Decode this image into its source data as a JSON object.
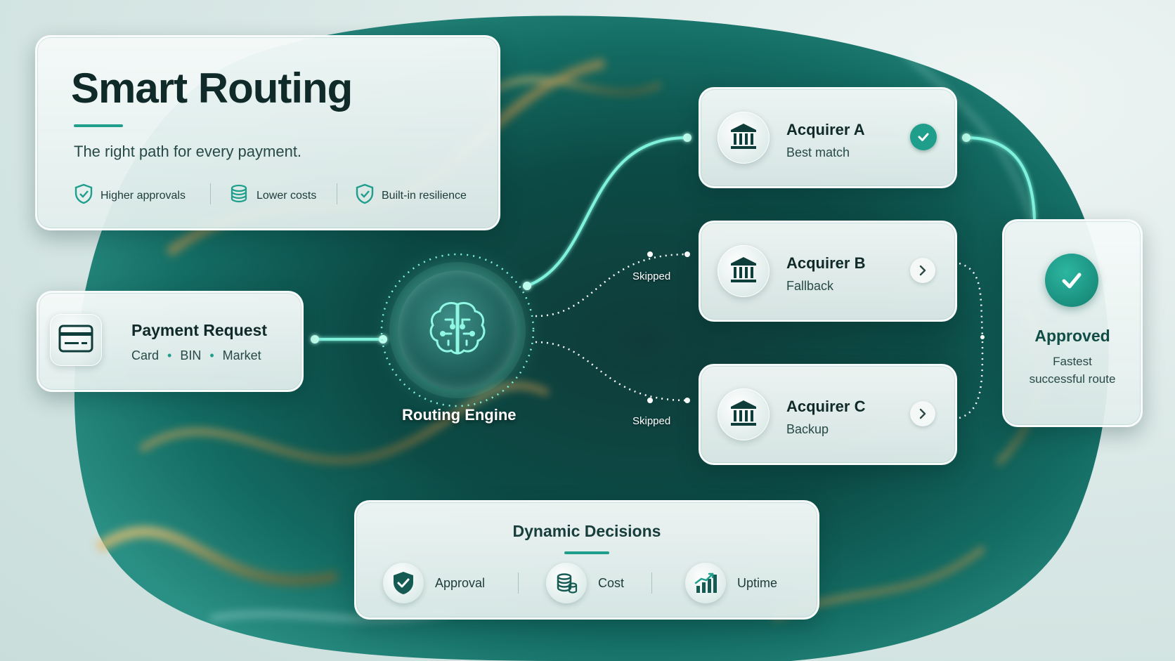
{
  "header": {
    "title": "Smart Routing",
    "subtitle": "The right path for every payment.",
    "features": [
      "Higher approvals",
      "Lower costs",
      "Built-in resilience"
    ]
  },
  "payment_request": {
    "title": "Payment Request",
    "attributes": [
      "Card",
      "BIN",
      "Market"
    ],
    "separator": "•"
  },
  "engine": {
    "label": "Routing Engine"
  },
  "acquirers": [
    {
      "name": "Acquirer A",
      "role": "Best match",
      "status": "selected"
    },
    {
      "name": "Acquirer B",
      "role": "Fallback",
      "status": "skipped"
    },
    {
      "name": "Acquirer C",
      "role": "Backup",
      "status": "skipped"
    }
  ],
  "skipped_label": "Skipped",
  "result": {
    "title": "Approved",
    "line1": "Fastest",
    "line2": "successful route"
  },
  "decisions": {
    "title": "Dynamic Decisions",
    "items": [
      "Approval",
      "Cost",
      "Uptime"
    ]
  },
  "colors": {
    "accent": "#1f9e8c",
    "glow": "#7ff2dc",
    "text_dark": "#0f2a28"
  }
}
